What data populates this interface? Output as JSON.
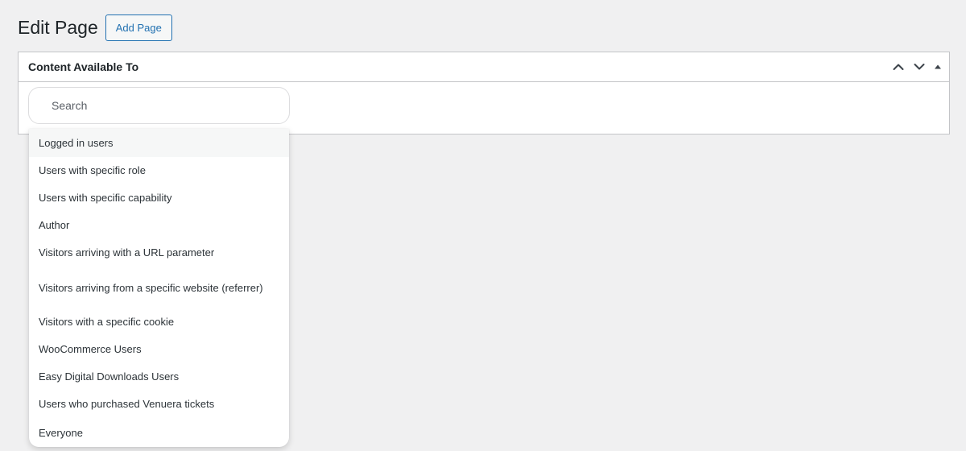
{
  "header": {
    "title": "Edit Page",
    "add_button_label": "Add Page"
  },
  "metabox": {
    "title": "Content Available To",
    "actions": [
      "move-up",
      "move-down",
      "toggle-panel"
    ]
  },
  "search": {
    "placeholder": "Search",
    "value": ""
  },
  "dropdown": {
    "highlighted_index": 0,
    "options": [
      "Logged in users",
      "Users with specific role",
      "Users with specific capability",
      "Author",
      "Visitors arriving with a URL parameter",
      "Visitors arriving from a specific website (referrer)",
      "Visitors with a specific cookie",
      "WooCommerce Users",
      "Easy Digital Downloads Users",
      "Users who purchased Venuera tickets",
      "Everyone"
    ]
  },
  "colors": {
    "background": "#f0f0f1",
    "accent": "#2271b1",
    "border": "#c3c4c7",
    "text": "#1d2327"
  }
}
